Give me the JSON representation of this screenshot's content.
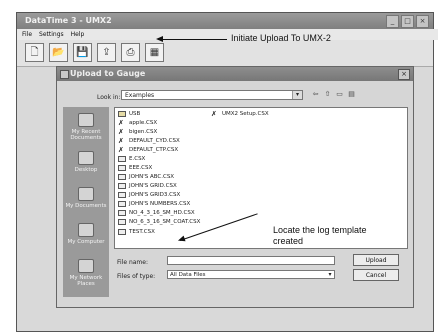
{
  "window": {
    "title": "DataTime 3 - UMX2",
    "controls": [
      "_",
      "□",
      "×"
    ]
  },
  "menu": [
    "File",
    "Settings",
    "Help"
  ],
  "toolbar": {
    "buttons": [
      {
        "name": "new-icon",
        "glyph": "🗋"
      },
      {
        "name": "open-icon",
        "glyph": "📂"
      },
      {
        "name": "save-icon",
        "glyph": "💾"
      },
      {
        "name": "upload-icon",
        "glyph": "⇪"
      },
      {
        "name": "print-icon",
        "glyph": "⎙"
      },
      {
        "name": "grid-icon",
        "glyph": "▦"
      }
    ],
    "annotation": "Initiate Upload To UMX-2"
  },
  "dialog": {
    "title": "Upload to Gauge",
    "close": "×",
    "look_in_label": "Look in:",
    "look_in_value": "Examples",
    "places": [
      "My Recent Documents",
      "Desktop",
      "My Documents",
      "My Computer",
      "My Network Places"
    ],
    "files_left": [
      "USB",
      "apple.CSX",
      "bigen.CSX",
      "DEFAULT_CYD.CSX",
      "DEFAULT_CTP.CSX",
      "E.CSX",
      "EEE.CSX",
      "JOHN'S ABC.CSX",
      "JOHN'S GRID.CSX",
      "JOHN'S GRID3.CSX",
      "JOHN'S NUMBERS.CSX",
      "NO_4_3_16_SM_HD.CSX",
      "NO_6_3_16_SM_COAT.CSX",
      "TEST.CSX"
    ],
    "files_right": [
      "UMX2 Setup.CSX"
    ],
    "file_name_label": "File name:",
    "file_name_value": "",
    "files_type_label": "Files of type:",
    "files_type_value": "All Data Files",
    "upload_button": "Upload",
    "cancel_button": "Cancel",
    "annotation": "Locate the log template created"
  }
}
